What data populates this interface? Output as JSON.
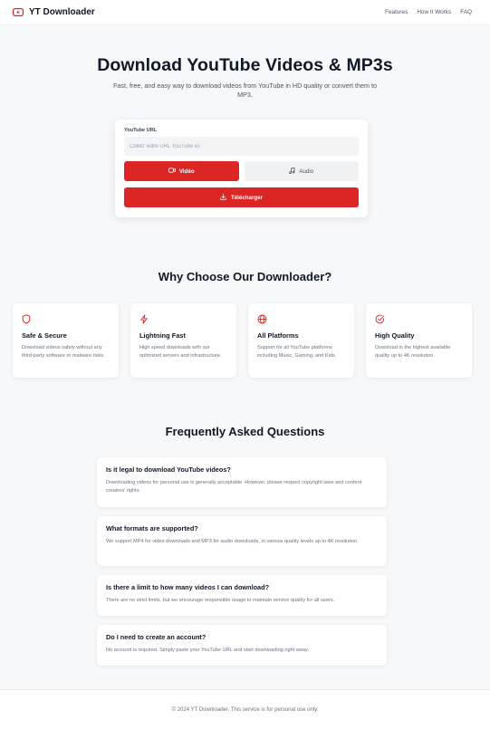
{
  "colors": {
    "accent": "#dc2626",
    "text": "#111827",
    "muted": "#6b7280",
    "background": "#f7f8fa"
  },
  "header": {
    "brand_icon": "youtube-play-icon",
    "brand": "YT Downloader",
    "nav": [
      "Features",
      "How It Works",
      "FAQ"
    ]
  },
  "hero": {
    "title": "Download YouTube Videos & MP3s",
    "subtitle": "Fast, free, and easy way to download videos from YouTube in HD quality or convert them to MP3."
  },
  "form": {
    "url_label": "YouTube URL",
    "url_placeholder": "Collez votre URL YouTube ici",
    "url_value": "",
    "video_label": "Vidéo",
    "video_icon": "video-camera-icon",
    "audio_label": "Audio",
    "audio_icon": "music-note-icon",
    "selected_mode": "Vidéo",
    "download_label": "Télécharger",
    "download_icon": "download-icon"
  },
  "features": {
    "title": "Why Choose Our Downloader?",
    "items": [
      {
        "icon": "shield-icon",
        "title": "Safe & Secure",
        "desc": "Download videos safely without any third-party software or malware risks."
      },
      {
        "icon": "lightning-icon",
        "title": "Lightning Fast",
        "desc": "High speed downloads with our optimized servers and infrastructure."
      },
      {
        "icon": "globe-icon",
        "title": "All Platforms",
        "desc": "Support for all YouTube platforms including Music, Gaming, and Kids."
      },
      {
        "icon": "check-circle-icon",
        "title": "High Quality",
        "desc": "Download in the highest available quality up to 4K resolution."
      }
    ]
  },
  "faq": {
    "title": "Frequently Asked Questions",
    "items": [
      {
        "q": "Is it legal to download YouTube videos?",
        "a": "Downloading videos for personal use is generally acceptable. However, please respect copyright laws and content creators' rights."
      },
      {
        "q": "What formats are supported?",
        "a": "We support MP4 for video downloads and MP3 for audio downloads, in various quality levels up to 4K resolution."
      },
      {
        "q": "Is there a limit to how many videos I can download?",
        "a": "There are no strict limits, but we encourage responsible usage to maintain service quality for all users."
      },
      {
        "q": "Do I need to create an account?",
        "a": "No account is required. Simply paste your YouTube URL and start downloading right away."
      }
    ]
  },
  "footer": {
    "text": "© 2024 YT Downloader. This service is for personal use only."
  }
}
